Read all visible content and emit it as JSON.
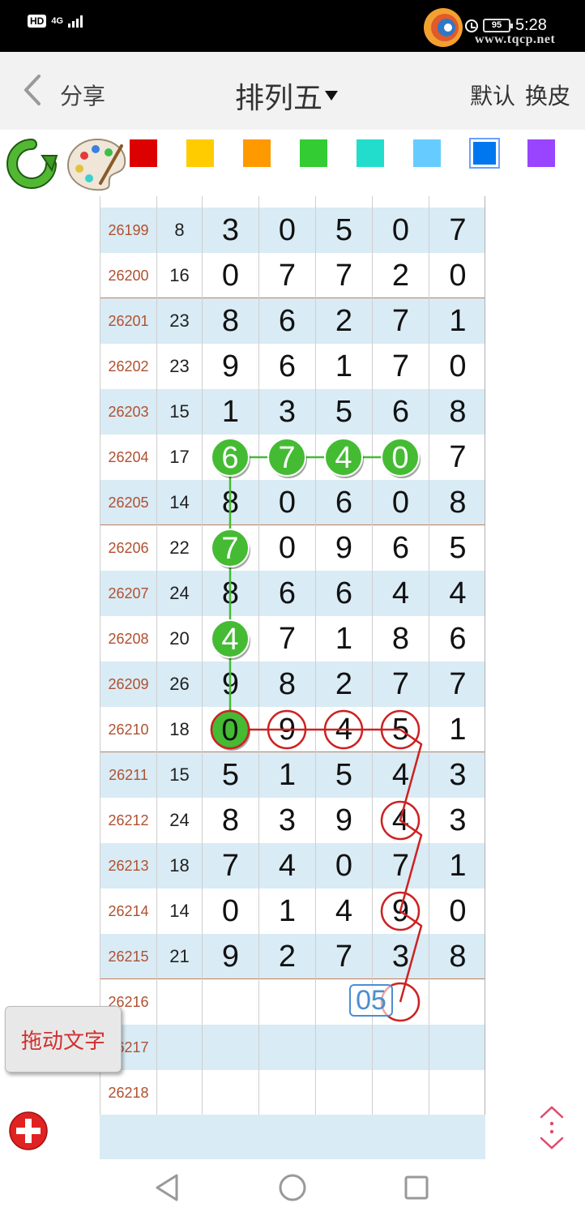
{
  "status_bar": {
    "hd": "HD",
    "network": "4G",
    "battery": "95",
    "time": "5:28",
    "watermark_url": "www.tqcp.net"
  },
  "header": {
    "share": "分享",
    "title": "排列五",
    "default": "默认",
    "skin": "换皮"
  },
  "toolbar": {
    "refresh_icon": "refresh-arrow-icon",
    "palette_icon": "palette-icon",
    "swatches": [
      "#dd0000",
      "#ffcc00",
      "#ff9900",
      "#33cc33",
      "#22ddcc",
      "#66ccff",
      "#0077ee",
      "#9944ff"
    ],
    "selected_swatch": 6
  },
  "grid": {
    "rows": [
      {
        "issue": "26199",
        "sum": "8",
        "digits": [
          "3",
          "0",
          "5",
          "0",
          "7"
        ]
      },
      {
        "issue": "26200",
        "sum": "16",
        "digits": [
          "0",
          "7",
          "7",
          "2",
          "0"
        ]
      },
      {
        "issue": "26201",
        "sum": "23",
        "digits": [
          "8",
          "6",
          "2",
          "7",
          "1"
        ]
      },
      {
        "issue": "26202",
        "sum": "23",
        "digits": [
          "9",
          "6",
          "1",
          "7",
          "0"
        ]
      },
      {
        "issue": "26203",
        "sum": "15",
        "digits": [
          "1",
          "3",
          "5",
          "6",
          "8"
        ]
      },
      {
        "issue": "26204",
        "sum": "17",
        "digits": [
          "6",
          "7",
          "4",
          "0",
          "7"
        ]
      },
      {
        "issue": "26205",
        "sum": "14",
        "digits": [
          "8",
          "0",
          "6",
          "0",
          "8"
        ]
      },
      {
        "issue": "26206",
        "sum": "22",
        "digits": [
          "7",
          "0",
          "9",
          "6",
          "5"
        ]
      },
      {
        "issue": "26207",
        "sum": "24",
        "digits": [
          "8",
          "6",
          "6",
          "4",
          "4"
        ]
      },
      {
        "issue": "26208",
        "sum": "20",
        "digits": [
          "4",
          "7",
          "1",
          "8",
          "6"
        ]
      },
      {
        "issue": "26209",
        "sum": "26",
        "digits": [
          "9",
          "8",
          "2",
          "7",
          "7"
        ]
      },
      {
        "issue": "26210",
        "sum": "18",
        "digits": [
          "0",
          "9",
          "4",
          "5",
          "1"
        ]
      },
      {
        "issue": "26211",
        "sum": "15",
        "digits": [
          "5",
          "1",
          "5",
          "4",
          "3"
        ]
      },
      {
        "issue": "26212",
        "sum": "24",
        "digits": [
          "8",
          "3",
          "9",
          "4",
          "3"
        ]
      },
      {
        "issue": "26213",
        "sum": "18",
        "digits": [
          "7",
          "4",
          "0",
          "7",
          "1"
        ]
      },
      {
        "issue": "26214",
        "sum": "14",
        "digits": [
          "0",
          "1",
          "4",
          "9",
          "0"
        ]
      },
      {
        "issue": "26215",
        "sum": "21",
        "digits": [
          "9",
          "2",
          "7",
          "3",
          "8"
        ]
      },
      {
        "issue": "26216",
        "sum": "",
        "digits": [
          "",
          "",
          "",
          "",
          ""
        ]
      },
      {
        "issue": "26217",
        "sum": "",
        "digits": [
          "",
          "",
          "",
          "",
          ""
        ]
      },
      {
        "issue": "26218",
        "sum": "",
        "digits": [
          "",
          "",
          "",
          "",
          ""
        ]
      }
    ],
    "prediction": "05",
    "green_marks": [
      {
        "row": 5,
        "col": 0
      },
      {
        "row": 5,
        "col": 1
      },
      {
        "row": 5,
        "col": 2
      },
      {
        "row": 5,
        "col": 3
      },
      {
        "row": 7,
        "col": 0
      },
      {
        "row": 9,
        "col": 0
      },
      {
        "row": 11,
        "col": 0
      }
    ],
    "red_marks": [
      {
        "row": 11,
        "col": 0
      },
      {
        "row": 11,
        "col": 1
      },
      {
        "row": 11,
        "col": 2
      },
      {
        "row": 11,
        "col": 3
      },
      {
        "row": 13,
        "col": 3
      },
      {
        "row": 15,
        "col": 3
      },
      {
        "row": 17,
        "col": 3
      }
    ],
    "green_color": "#44bb33",
    "red_color": "#cc2222"
  },
  "drag_text": "拖动文字",
  "add_icon": "add-circle-icon",
  "scroll_icon": "scroll-arrows-icon",
  "nav": {
    "back": "nav-back-icon",
    "home": "nav-home-icon",
    "recent": "nav-recent-icon"
  }
}
